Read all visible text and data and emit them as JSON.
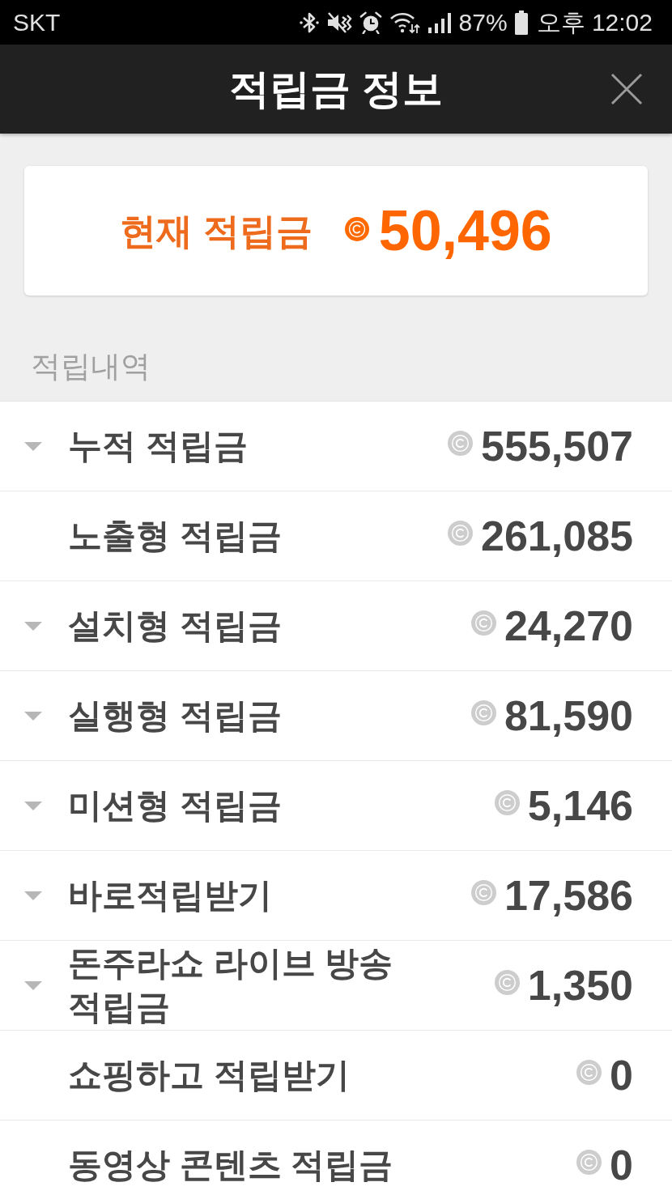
{
  "status_bar": {
    "carrier": "SKT",
    "battery": "87%",
    "time": "오후 12:02"
  },
  "header": {
    "title": "적립금 정보"
  },
  "balance": {
    "label": "현재 적립금",
    "amount": "50,496"
  },
  "section": {
    "title": "적립내역"
  },
  "rows": [
    {
      "label": "누적 적립금",
      "amount": "555,507",
      "expandable": true
    },
    {
      "label": "노출형 적립금",
      "amount": "261,085",
      "expandable": false
    },
    {
      "label": "설치형 적립금",
      "amount": "24,270",
      "expandable": true
    },
    {
      "label": "실행형 적립금",
      "amount": "81,590",
      "expandable": true
    },
    {
      "label": "미션형 적립금",
      "amount": "5,146",
      "expandable": true
    },
    {
      "label": "바로적립받기",
      "amount": "17,586",
      "expandable": true
    },
    {
      "label": "돈주라쇼 라이브 방송 적립금",
      "amount": "1,350",
      "expandable": true
    },
    {
      "label": "쇼핑하고 적립받기",
      "amount": "0",
      "expandable": false
    },
    {
      "label": "동영상 콘텐츠 적립금",
      "amount": "0",
      "expandable": false
    }
  ]
}
